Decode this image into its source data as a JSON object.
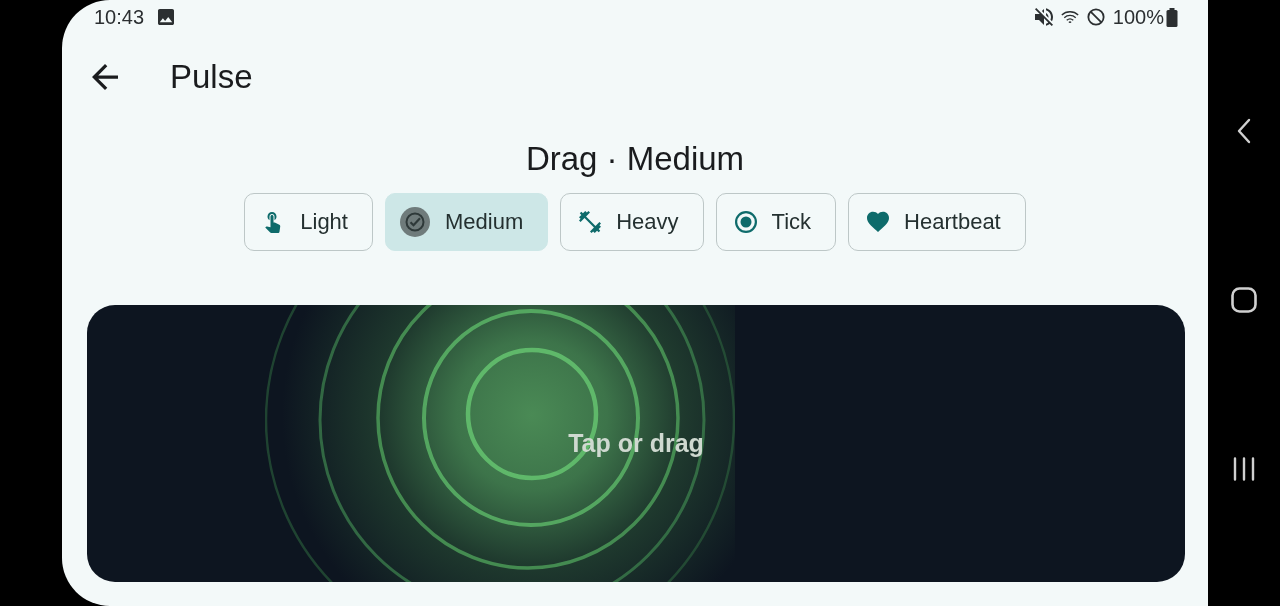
{
  "status_bar": {
    "time": "10:43",
    "battery": "100%"
  },
  "app_bar": {
    "title": "Pulse"
  },
  "subtitle": "Drag · Medium",
  "chips": [
    {
      "label": "Light",
      "selected": false
    },
    {
      "label": "Medium",
      "selected": true
    },
    {
      "label": "Heavy",
      "selected": false
    },
    {
      "label": "Tick",
      "selected": false
    },
    {
      "label": "Heartbeat",
      "selected": false
    }
  ],
  "pad": {
    "label": "Tap or drag"
  }
}
